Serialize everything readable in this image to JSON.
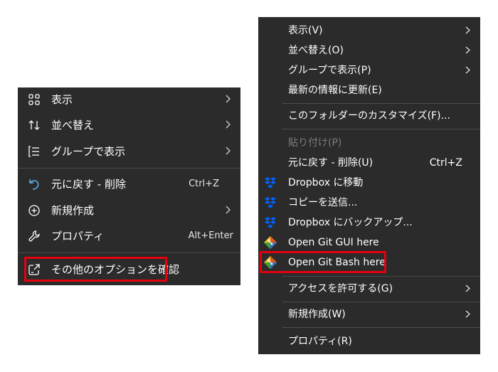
{
  "colors": {
    "menu_background": "#2b2b2b",
    "highlight_border": "#e3000f",
    "separator": "#4a4a4a",
    "disabled_text": "#7d7d7d",
    "dropbox_blue": "#0061fe"
  },
  "left_menu": {
    "items": [
      {
        "label": "表示",
        "icon": "grid-view-icon",
        "submenu": true
      },
      {
        "label": "並べ替え",
        "icon": "sort-arrows-icon",
        "submenu": true
      },
      {
        "label": "グループで表示",
        "icon": "group-list-icon",
        "submenu": true
      },
      {
        "label": "元に戻す - 削除",
        "icon": "undo-icon",
        "shortcut": "Ctrl+Z"
      },
      {
        "label": "新規作成",
        "icon": "new-plus-icon",
        "submenu": true
      },
      {
        "label": "プロパティ",
        "icon": "wrench-icon",
        "shortcut": "Alt+Enter"
      },
      {
        "label": "その他のオプションを確認",
        "icon": "open-external-icon",
        "highlighted": true
      }
    ]
  },
  "right_menu": {
    "items": [
      {
        "label": "表示(V)",
        "submenu": true
      },
      {
        "label": "並べ替え(O)",
        "submenu": true
      },
      {
        "label": "グループで表示(P)",
        "submenu": true
      },
      {
        "label": "最新の情報に更新(E)"
      },
      {
        "label": "このフォルダーのカスタマイズ(F)..."
      },
      {
        "label": "貼り付け(P)",
        "disabled": true
      },
      {
        "label": "元に戻す - 削除(U)",
        "shortcut": "Ctrl+Z"
      },
      {
        "label": "Dropbox に移動",
        "icon": "dropbox-icon"
      },
      {
        "label": "コピーを送信...",
        "icon": "dropbox-icon"
      },
      {
        "label": "Dropbox にバックアップ...",
        "icon": "dropbox-icon"
      },
      {
        "label": "Open Git GUI here",
        "icon": "git-icon"
      },
      {
        "label": "Open Git Bash here",
        "icon": "git-icon",
        "highlighted": true
      },
      {
        "label": "アクセスを許可する(G)",
        "submenu": true
      },
      {
        "label": "新規作成(W)",
        "submenu": true
      },
      {
        "label": "プロパティ(R)"
      }
    ]
  }
}
